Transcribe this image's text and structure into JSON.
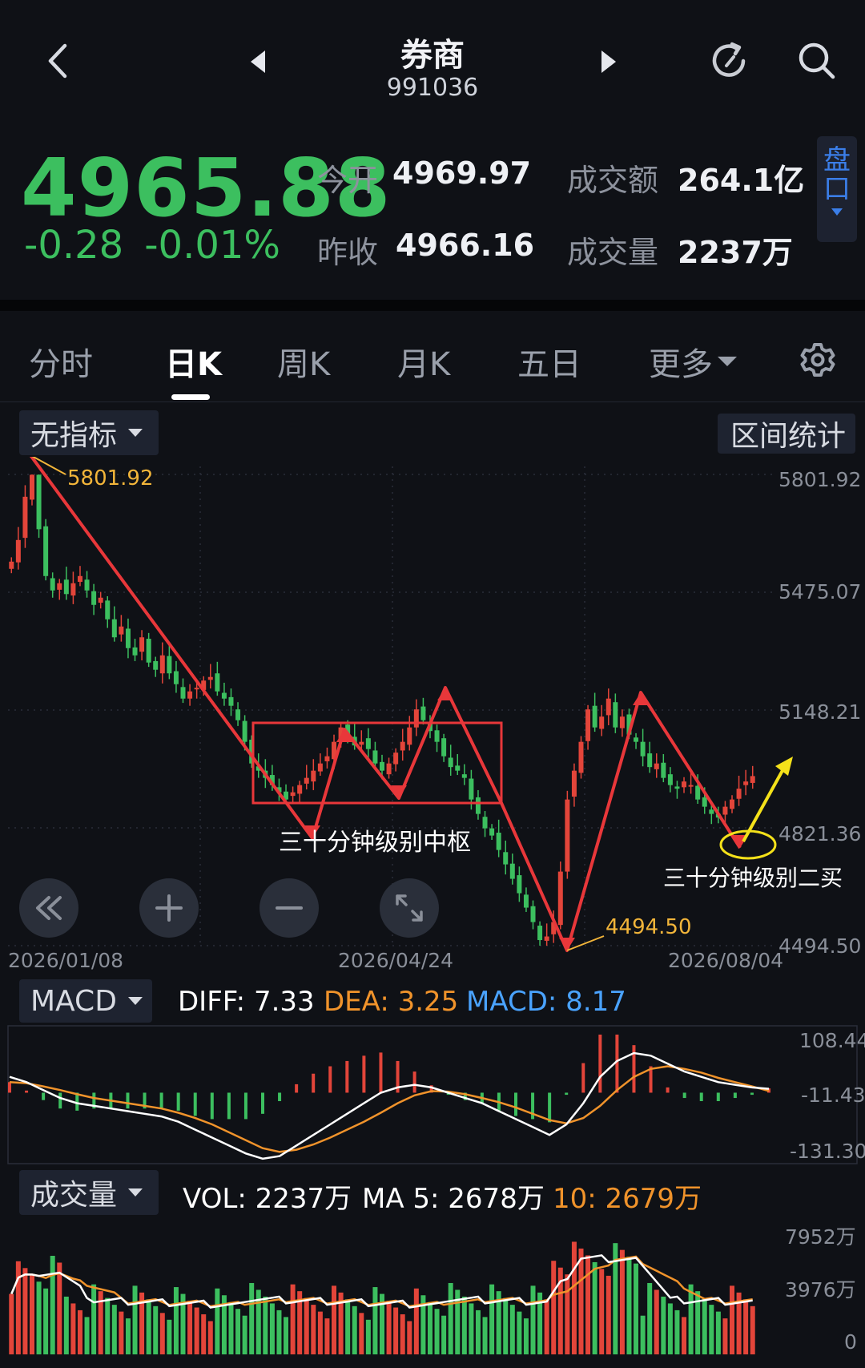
{
  "header": {
    "title": "券商",
    "code": "991036"
  },
  "quote": {
    "price": "4965.88",
    "change": "-0.28",
    "change_pct": "-0.01%",
    "open_label": "今开",
    "open_value": "4969.97",
    "prev_close_label": "昨收",
    "prev_close_value": "4966.16",
    "turnover_label": "成交额",
    "turnover_value": "264.1亿",
    "volume_label": "成交量",
    "volume_value": "2237万",
    "pankou_line1": "盘",
    "pankou_line2": "口",
    "up_color": "#e3453a",
    "down_color": "#3cbf5f"
  },
  "tabs": [
    {
      "label": "分时"
    },
    {
      "label": "日K"
    },
    {
      "label": "周K"
    },
    {
      "label": "月K"
    },
    {
      "label": "五日"
    },
    {
      "label": "更多"
    }
  ],
  "main_chart": {
    "indicator_label": "无指标",
    "range_stats_label": "区间统计",
    "high_label": "5801.92",
    "low_label": "4494.50",
    "y_ticks": [
      "5801.92",
      "5475.07",
      "5148.21",
      "4821.36",
      "4494.50"
    ],
    "x_ticks": [
      "2026/01/08",
      "2026/04/24",
      "2026/08/04"
    ],
    "annotation_center": "三十分钟级别中枢",
    "annotation_buy": "三十分钟级别二买"
  },
  "macd": {
    "label": "MACD",
    "diff": "DIFF: 7.33",
    "dea": "DEA: 3.25",
    "macd": "MACD: 8.17",
    "diff_color": "#ffffff",
    "dea_color": "#f0932b",
    "macd_color": "#4aa3ff",
    "y_ticks": [
      "108.44",
      "-11.43",
      "-131.30"
    ]
  },
  "volume": {
    "label": "成交量",
    "vol": "VOL: 2237万",
    "ma5": "MA 5: 2678万",
    "ma10": "10: 2679万",
    "y_ticks": [
      "7952万",
      "3976万",
      "0"
    ]
  },
  "chart_data": [
    {
      "type": "candlestick",
      "title": "",
      "x_range": [
        "2026/01/08",
        "2026/08/04"
      ],
      "ylim": [
        4494.5,
        5801.92
      ],
      "y_ticks": [
        5801.92,
        5475.07,
        5148.21,
        4821.36,
        4494.5
      ],
      "marked_high": 5801.92,
      "marked_low": 4494.5,
      "close_approx": [
        5560,
        5620,
        5740,
        5801,
        5650,
        5520,
        5480,
        5500,
        5470,
        5500,
        5520,
        5480,
        5440,
        5460,
        5400,
        5350,
        5380,
        5320,
        5300,
        5350,
        5280,
        5260,
        5300,
        5250,
        5220,
        5180,
        5200,
        5210,
        5230,
        5240,
        5200,
        5180,
        5160,
        5120,
        5060,
        5000,
        4980,
        4960,
        4940,
        4920,
        4900,
        4920,
        4940,
        4960,
        4980,
        5000,
        5020,
        5060,
        5100,
        5080,
        5050,
        5060,
        5040,
        5000,
        4980,
        5000,
        5030,
        5060,
        5100,
        5150,
        5120,
        5090,
        5060,
        5020,
        4990,
        4980,
        4960,
        4900,
        4860,
        4820,
        4800,
        4760,
        4720,
        4680,
        4640,
        4600,
        4560,
        4510,
        4520,
        4560,
        4700,
        4900,
        4980,
        5060,
        5150,
        5100,
        5130,
        5180,
        5100,
        5130,
        5080,
        5060,
        5020,
        4990,
        5000,
        4960,
        4940,
        4930,
        4950,
        4940,
        4900,
        4880,
        4860,
        4850,
        4880,
        4900,
        4930,
        4950,
        4965
      ],
      "chanlun_lines": {
        "down_1": [
          [
            "2026/01/08",
            5801.92
          ],
          [
            "center_low",
            4880
          ]
        ],
        "center_zone": [
          4920,
          5160
        ],
        "bottom": 4494.5,
        "second_buy_point": 4860
      }
    },
    {
      "type": "line",
      "title": "MACD",
      "ylim": [
        -131.3,
        108.44
      ],
      "y_ticks": [
        108.44,
        -11.43,
        -131.3
      ],
      "series": [
        {
          "name": "DIFF",
          "last": 7.33,
          "values": [
            30,
            20,
            5,
            -10,
            -20,
            -25,
            -30,
            -35,
            -40,
            -45,
            -55,
            -70,
            -85,
            -100,
            -115,
            -125,
            -120,
            -100,
            -80,
            -60,
            -40,
            -20,
            0,
            10,
            15,
            10,
            0,
            -10,
            -20,
            -35,
            -50,
            -65,
            -80,
            -60,
            -20,
            30,
            60,
            75,
            70,
            55,
            40,
            30,
            20,
            15,
            10,
            7.33
          ]
        },
        {
          "name": "DEA",
          "last": 3.25,
          "values": [
            20,
            18,
            12,
            5,
            -3,
            -10,
            -15,
            -20,
            -25,
            -30,
            -38,
            -48,
            -60,
            -75,
            -90,
            -105,
            -112,
            -108,
            -98,
            -85,
            -70,
            -55,
            -38,
            -20,
            -5,
            3,
            2,
            -3,
            -10,
            -18,
            -28,
            -40,
            -52,
            -58,
            -48,
            -25,
            5,
            30,
            45,
            50,
            45,
            38,
            28,
            20,
            12,
            3.25
          ]
        },
        {
          "name": "MACD",
          "last": 8.17
        }
      ]
    },
    {
      "type": "bar",
      "title": "成交量",
      "ylim": [
        0,
        7952
      ],
      "y_ticks": [
        7952,
        3976,
        0
      ],
      "series": [
        {
          "name": "VOL",
          "last": 2237
        },
        {
          "name": "MA 5",
          "last": 2678
        },
        {
          "name": "10",
          "last": 2679
        }
      ]
    }
  ]
}
